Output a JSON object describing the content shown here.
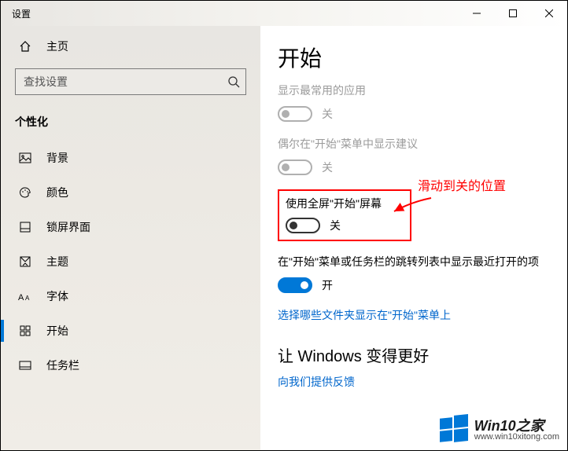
{
  "window": {
    "title": "设置"
  },
  "sidebar": {
    "home": "主页",
    "search_placeholder": "查找设置",
    "category": "个性化",
    "items": [
      {
        "label": "背景"
      },
      {
        "label": "颜色"
      },
      {
        "label": "锁屏界面"
      },
      {
        "label": "主题"
      },
      {
        "label": "字体"
      },
      {
        "label": "开始"
      },
      {
        "label": "任务栏"
      }
    ]
  },
  "content": {
    "title": "开始",
    "opt1": {
      "label": "显示最常用的应用",
      "state": "关"
    },
    "opt2": {
      "label": "偶尔在\"开始\"菜单中显示建议",
      "state": "关"
    },
    "opt3": {
      "label": "使用全屏\"开始\"屏幕",
      "state": "关"
    },
    "opt4": {
      "label": "在\"开始\"菜单或任务栏的跳转列表中显示最近打开的项",
      "state": "开"
    },
    "link1": "选择哪些文件夹显示在\"开始\"菜单上",
    "heading2": "让 Windows 变得更好",
    "link2": "向我们提供反馈"
  },
  "annotation": "滑动到关的位置",
  "watermark": {
    "title": "Win10之家",
    "url": "www.win10xitong.com"
  }
}
